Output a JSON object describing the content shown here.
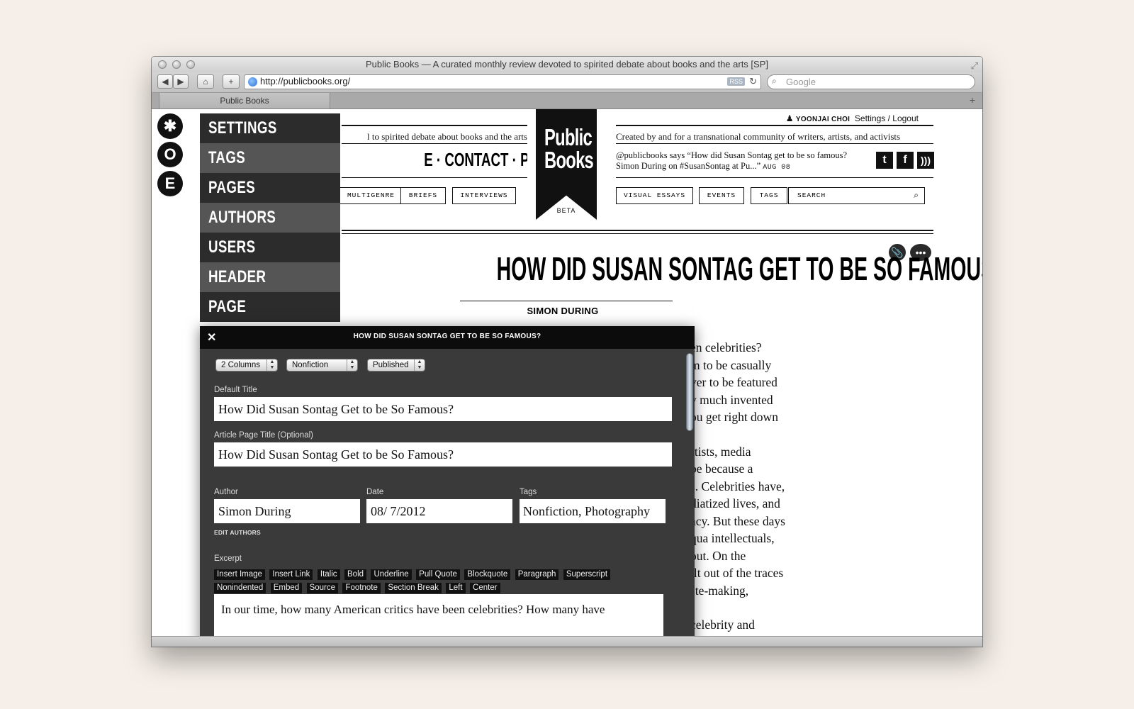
{
  "browser": {
    "window_title": "Public Books — A curated monthly review devoted to spirited debate about books and the arts [SP]",
    "url": "http://publicbooks.org/",
    "rss_label": "RSS",
    "search_placeholder": "Google",
    "tab_label": "Public Books",
    "new_tab": "+",
    "back": "◀",
    "forward": "▶",
    "home": "⌂",
    "add": "+",
    "reload": "↻"
  },
  "sidebar_icons": [
    {
      "icon": "gear-icon",
      "glyph": "✱"
    },
    {
      "icon": "o-icon",
      "glyph": "O"
    },
    {
      "icon": "e-icon",
      "glyph": "E"
    }
  ],
  "cms_menu": {
    "items": [
      "SETTINGS",
      "TAGS",
      "PAGES",
      "AUTHORS",
      "USERS",
      "HEADER",
      "PAGE MODULES"
    ]
  },
  "site": {
    "tagline_left": "l to spirited debate about books and the arts",
    "nav_text": "E · CONTACT · PUBLIC CULTURE",
    "categories_left": [
      "MULTIGENRE",
      "BRIEFS",
      "INTERVIEWS"
    ],
    "logo_line1": "Public",
    "logo_line2": "Books",
    "logo_beta": "BETA",
    "user_name": "YOONJAI CHOI",
    "user_links": "Settings / Logout",
    "tagline_right": "Created by and for a transnational community of writers, artists, and activists",
    "tweet_text": "@publicbooks says “How did Susan Sontag get to be so famous? Simon During on #SusanSontag at Pu...”",
    "tweet_date": "AUG 08",
    "social": [
      "t",
      "f",
      "rss"
    ],
    "categories_right": [
      "VISUAL ESSAYS",
      "EVENTS",
      "TAGS"
    ],
    "search_label": "SEARCH",
    "search_icon_glyph": "⌕"
  },
  "article": {
    "headline": "HOW DID SUSAN SONTAG GET TO BE SO FAMOUS?",
    "byline": "SIMON DURING",
    "paragraph1_lines": [
      "en celebrities?",
      "m to be casually",
      "ver to be featured",
      "y much invented",
      "ou get right down"
    ],
    "paragraph2_lines": [
      "rtists, media",
      "be because a",
      "s. Celebrities have,",
      "diatized lives, and",
      "acy. But these days",
      "qua intellectuals,",
      "out. On the",
      "ilt out of the traces",
      "ste-making,"
    ],
    "paragraph3_line": "celebrity and"
  },
  "editor": {
    "title": "HOW DID SUSAN SONTAG GET TO BE SO FAMOUS?",
    "close": "✕",
    "columns": "2 Columns",
    "section": "Nonfiction",
    "status": "Published",
    "default_title_label": "Default Title",
    "default_title_value": "How Did Susan Sontag Get to be So Famous?",
    "page_title_label": "Article Page Title (Optional)",
    "page_title_value": "How Did Susan Sontag Get to be So Famous?",
    "author_label": "Author",
    "author_value": "Simon During",
    "date_label": "Date",
    "date_value": "08/ 7/2012",
    "tags_label": "Tags",
    "tags_value": "Nonfiction, Photography",
    "edit_authors": "EDIT AUTHORS",
    "excerpt_label": "Excerpt",
    "format_row1": [
      "Insert Image",
      "Insert Link",
      "Italic",
      "Bold",
      "Underline",
      "Pull Quote",
      "Blockquote",
      "Paragraph",
      "Superscript"
    ],
    "format_row2": [
      "Nonindented",
      "Embed",
      "Source",
      "Footnote",
      "Section Break",
      "Left",
      "Center"
    ],
    "excerpt_text": "In our time, how many American critics have been celebrities? How many have"
  }
}
